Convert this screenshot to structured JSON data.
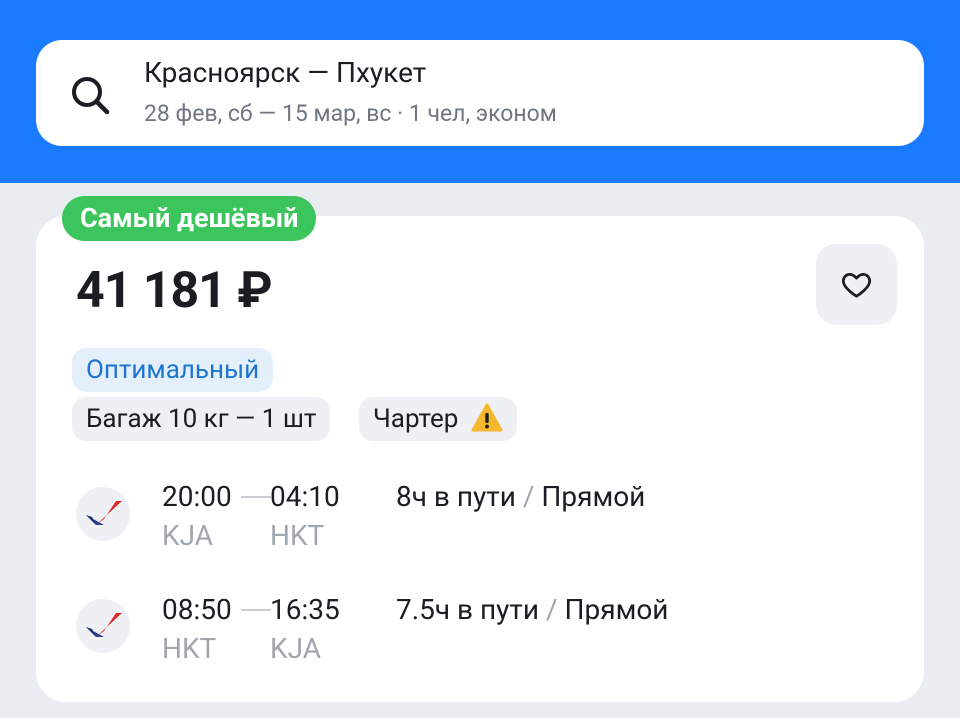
{
  "search": {
    "route": "Красноярск — Пхукет",
    "details": "28 фев, сб — 15 мар, вс · 1 чел, эконом"
  },
  "offer": {
    "badge": "Самый дешёвый",
    "price": "41 181 ₽",
    "tags": {
      "optimal": "Оптимальный",
      "baggage": "Багаж 10 кг — 1 шт",
      "charter": "Чартер"
    }
  },
  "flights": [
    {
      "depart_time": "20:00",
      "arrive_time": "04:10",
      "from": "KJA",
      "to": "HKT",
      "duration": "8ч в пути",
      "separator": "/",
      "type": "Прямой"
    },
    {
      "depart_time": "08:50",
      "arrive_time": "16:35",
      "from": "HKT",
      "to": "KJA",
      "duration": "7.5ч в пути",
      "separator": "/",
      "type": "Прямой"
    }
  ],
  "colors": {
    "header": "#1a7bff",
    "badge": "#3cc55c",
    "optimal_chip": "#e3f0fc",
    "optimal_text": "#1d75d1",
    "warning": "#f5b82e"
  },
  "icons": {
    "search": "search-icon",
    "favorite": "heart-icon",
    "warning": "warning-icon",
    "airline": "airline-logo"
  }
}
